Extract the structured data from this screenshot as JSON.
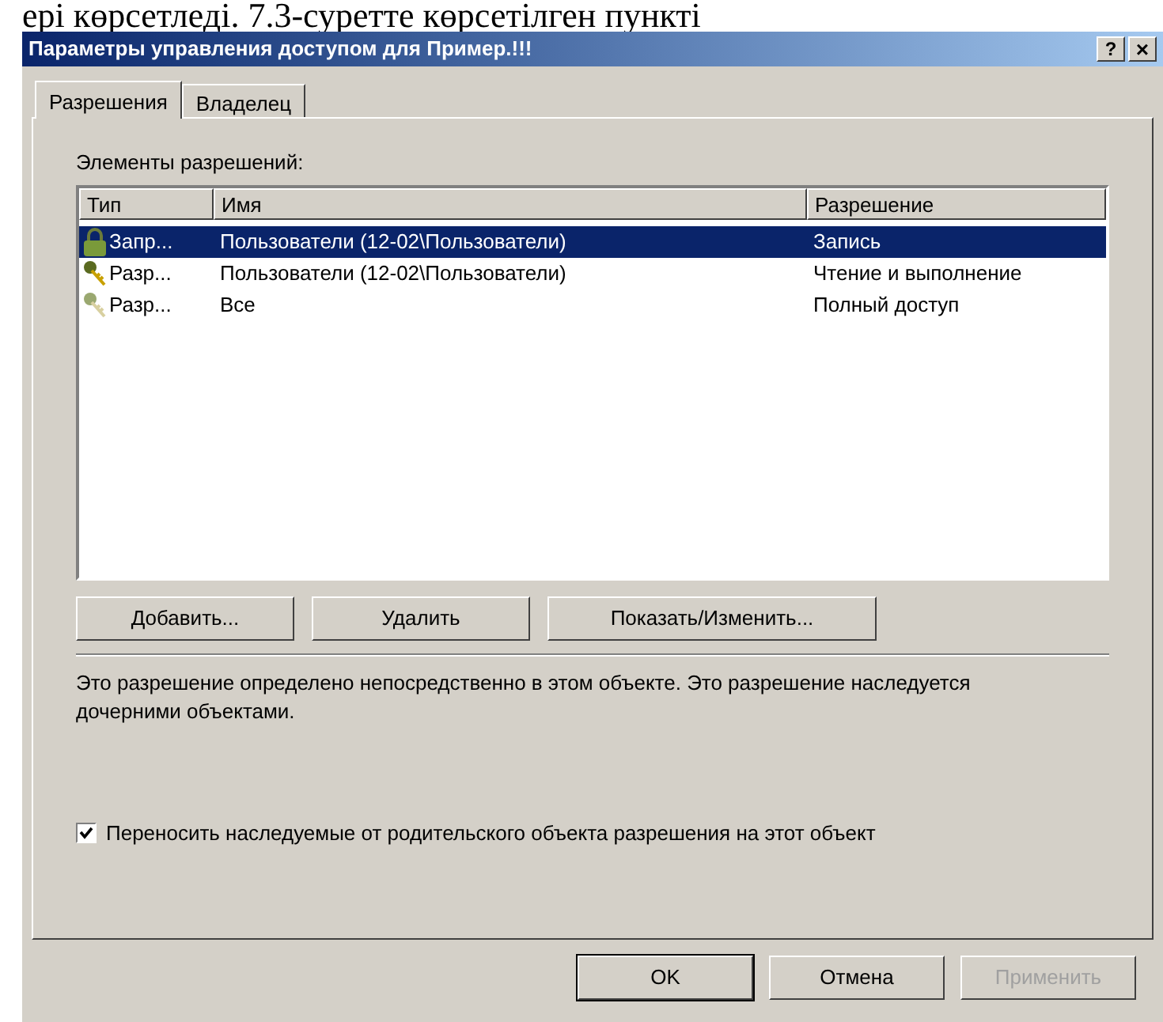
{
  "document_text": "ері көрсетледі. 7.3-суретте көрсетілген пункті",
  "window": {
    "title": "Параметры управления доступом для Пример.!!!",
    "help": "?",
    "close": "×"
  },
  "tabs": [
    {
      "label": "Разрешения",
      "selected": true
    },
    {
      "label": "Владелец",
      "selected": false
    }
  ],
  "list_label": "Элементы разрешений:",
  "table": {
    "columns": [
      "Тип",
      "Имя",
      "Разрешение"
    ],
    "rows": [
      {
        "kind": "deny",
        "type": "Запр...",
        "name": "Пользователи (12-02\\Пользователи)",
        "permission": "Запись",
        "selected": true
      },
      {
        "kind": "allow",
        "type": "Разр...",
        "name": "Пользователи (12-02\\Пользователи)",
        "permission": "Чтение и выполнение",
        "selected": false
      },
      {
        "kind": "inherited",
        "type": "Разр...",
        "name": "Все",
        "permission": "Полный доступ",
        "selected": false
      }
    ]
  },
  "list_buttons": [
    "Добавить...",
    "Удалить",
    "Показать/Изменить..."
  ],
  "description": "Это разрешение определено непосредственно в этом объекте. Это разрешение наследуется дочерними объектами.",
  "inherit_checkbox": {
    "label": "Переносить наследуемые от родительского объекта разрешения на этот объект",
    "checked": true
  },
  "footer_buttons": [
    {
      "label": "OK",
      "disabled": false,
      "default": true
    },
    {
      "label": "Отмена",
      "disabled": false,
      "default": false
    },
    {
      "label": "Применить",
      "disabled": true,
      "default": false
    }
  ]
}
